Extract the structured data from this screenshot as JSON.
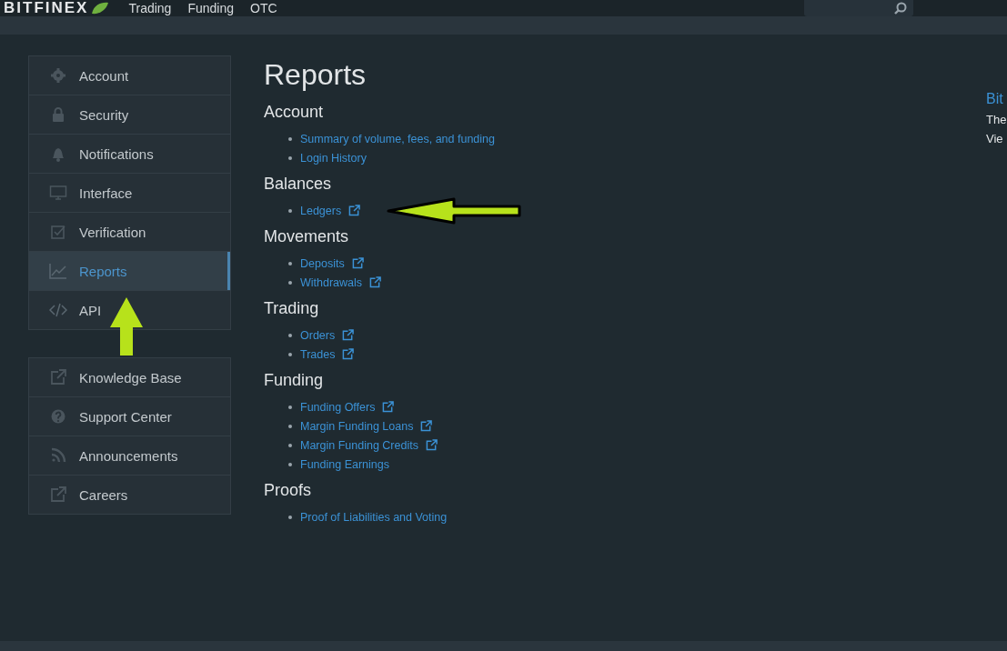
{
  "header": {
    "logo": "BITFINEX",
    "nav": [
      {
        "label": "Trading"
      },
      {
        "label": "Funding"
      },
      {
        "label": "OTC"
      }
    ]
  },
  "sidebar": {
    "groups": [
      [
        {
          "label": "Account",
          "selected": false
        },
        {
          "label": "Security",
          "selected": false
        },
        {
          "label": "Notifications",
          "selected": false
        },
        {
          "label": "Interface",
          "selected": false
        },
        {
          "label": "Verification",
          "selected": false
        },
        {
          "label": "Reports",
          "selected": true
        },
        {
          "label": "API",
          "selected": false
        }
      ],
      [
        {
          "label": "Knowledge Base",
          "selected": false
        },
        {
          "label": "Support Center",
          "selected": false
        },
        {
          "label": "Announcements",
          "selected": false
        },
        {
          "label": "Careers",
          "selected": false
        }
      ]
    ]
  },
  "page": {
    "title": "Reports",
    "sections": [
      {
        "heading": "Account",
        "links": [
          {
            "label": "Summary of volume, fees, and funding",
            "external": false
          },
          {
            "label": "Login History",
            "external": false
          }
        ]
      },
      {
        "heading": "Balances",
        "links": [
          {
            "label": "Ledgers",
            "external": true
          }
        ]
      },
      {
        "heading": "Movements",
        "links": [
          {
            "label": "Deposits",
            "external": true
          },
          {
            "label": "Withdrawals",
            "external": true
          }
        ]
      },
      {
        "heading": "Trading",
        "links": [
          {
            "label": "Orders",
            "external": true
          },
          {
            "label": "Trades",
            "external": true
          }
        ]
      },
      {
        "heading": "Funding",
        "links": [
          {
            "label": "Funding Offers",
            "external": true
          },
          {
            "label": "Margin Funding Loans",
            "external": true
          },
          {
            "label": "Margin Funding Credits",
            "external": true
          },
          {
            "label": "Funding Earnings",
            "external": false
          }
        ]
      },
      {
        "heading": "Proofs",
        "links": [
          {
            "label": "Proof of Liabilities and Voting",
            "external": false
          }
        ]
      }
    ]
  },
  "right_panel": {
    "title": "Bit",
    "lines": [
      "The",
      "Vie"
    ]
  }
}
